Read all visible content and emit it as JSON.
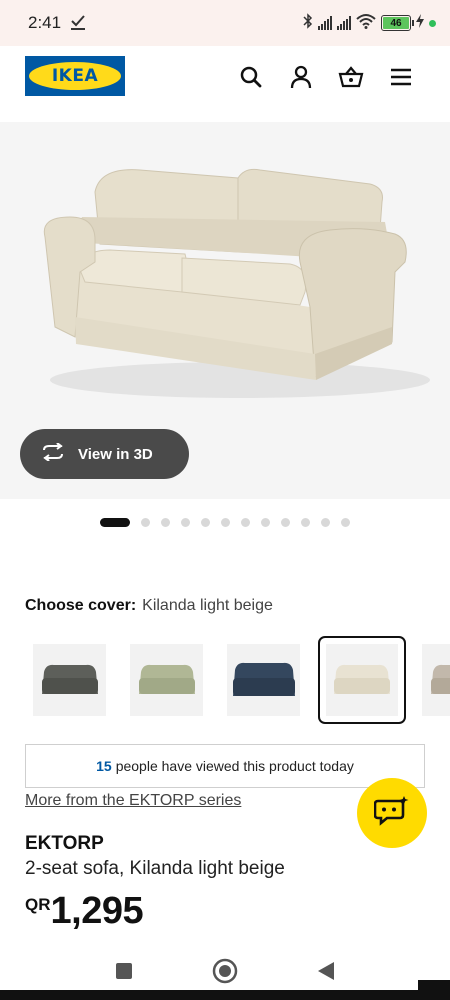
{
  "status_bar": {
    "time": "2:41",
    "battery": "46"
  },
  "header": {
    "logo": "IKEA",
    "icons": [
      "search-icon",
      "account-icon",
      "basket-icon",
      "menu-icon"
    ]
  },
  "gallery": {
    "view_3d_label": "View in 3D",
    "dot_count": 13,
    "active_dot": 0
  },
  "cover": {
    "label": "Choose cover:",
    "value": "Kilanda light beige",
    "swatches": [
      {
        "name": "dark gray",
        "color": "#5d5f5a"
      },
      {
        "name": "sage green",
        "color": "#a6ad8c"
      },
      {
        "name": "dark blue",
        "color": "#34475e"
      },
      {
        "name": "Kilanda light beige",
        "color": "#e8e2d2",
        "selected": true
      },
      {
        "name": "striped",
        "color": "#b9afa3"
      }
    ]
  },
  "viewed": {
    "count": "15",
    "text": "people have viewed this product today"
  },
  "series_link": "More from the EKTORP series",
  "product": {
    "name": "EKTORP",
    "description": "2-seat sofa, Kilanda light beige",
    "currency": "QR",
    "price": "1,295"
  },
  "colors": {
    "ikea_blue": "#0058a3",
    "ikea_yellow": "#ffda1a",
    "chat_yellow": "#ffdb00"
  }
}
